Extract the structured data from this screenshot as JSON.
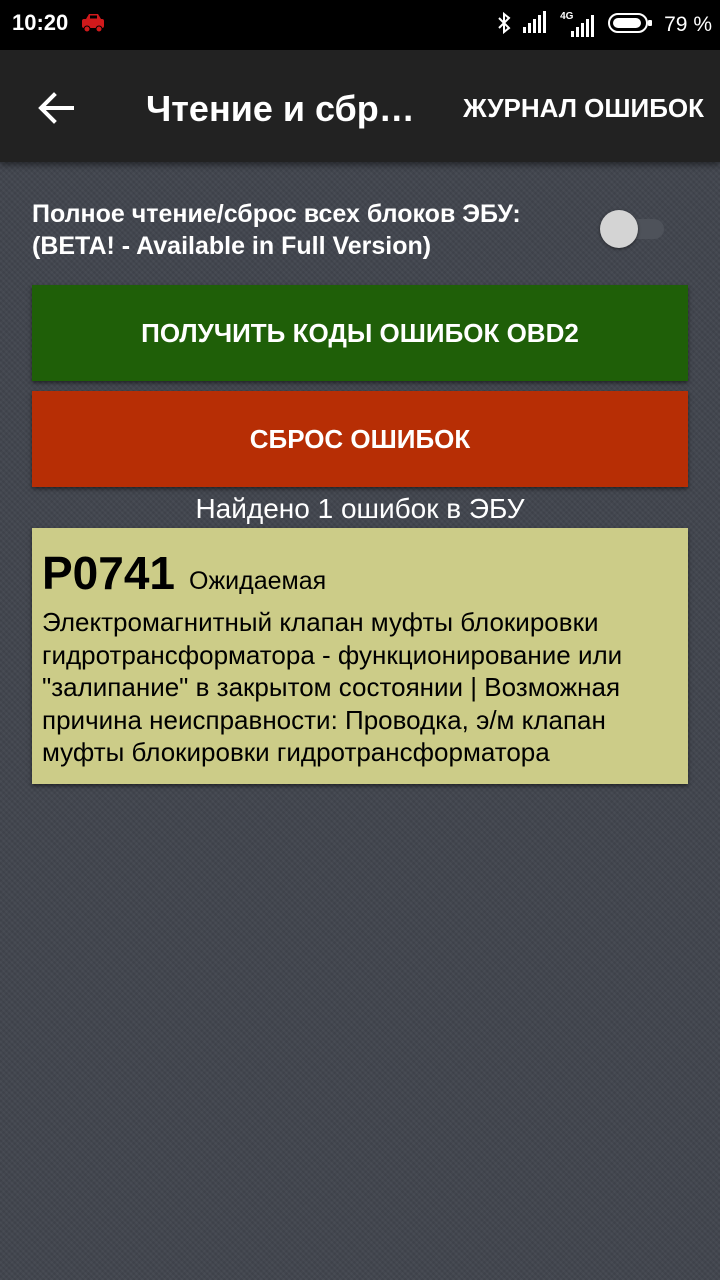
{
  "status_bar": {
    "time": "10:20",
    "battery_percent": "79 %",
    "network_label": "4G",
    "icons": [
      "car-notification-icon",
      "bluetooth-icon",
      "signal-icon",
      "signal-4g-icon",
      "battery-icon"
    ]
  },
  "app_bar": {
    "back_icon": "arrow-left-icon",
    "title": "Чтение и сбр…",
    "action_log": "ЖУРНАЛ ОШИБОК"
  },
  "full_read": {
    "line1": "Полное чтение/сброс всех блоков ЭБУ:",
    "line2": "(BETA! - Available in Full Version)",
    "toggle_on": false
  },
  "buttons": {
    "get_codes": "ПОЛУЧИТЬ КОДЫ ОШИБОК OBD2",
    "reset": "СБРОС ОШИБОК"
  },
  "result": {
    "found_text": "Найдено 1 ошибок в ЭБУ"
  },
  "errors": [
    {
      "code": "P0741",
      "status": "Ожидаемая",
      "description": "Электромагнитный клапан муфты блокировки гидротрансформатора - функционирование или \"залипание\" в закрытом состоянии | Возможная причина неисправности: Проводка, э/м клапан муфты блокировки гидротрансформатора"
    }
  ],
  "colors": {
    "background": "#40444d",
    "app_bar": "#222222",
    "get_button": "#1f5f08",
    "reset_button": "#b72e05",
    "error_card": "#cccc88"
  }
}
